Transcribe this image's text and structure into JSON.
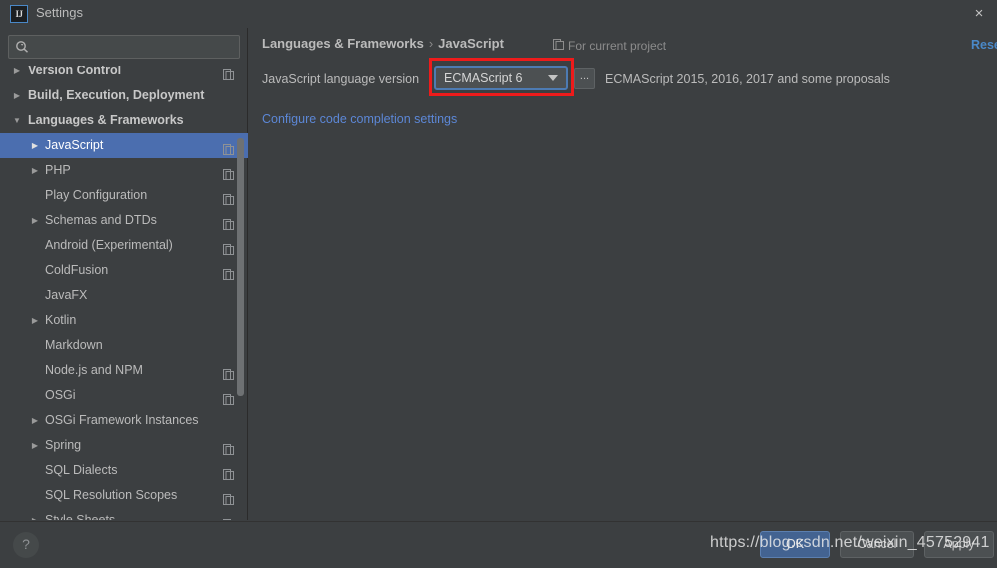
{
  "window": {
    "title": "Settings",
    "logo_text": "IJ",
    "close_icon": "×"
  },
  "search": {
    "value": "",
    "placeholder": ""
  },
  "sidebar": {
    "items": [
      {
        "label": "Version Control",
        "level": 0,
        "arrow": "▶",
        "group": true,
        "project_icon": true,
        "selected": false
      },
      {
        "label": "Build, Execution, Deployment",
        "level": 0,
        "arrow": "▶",
        "group": true,
        "project_icon": false,
        "selected": false
      },
      {
        "label": "Languages & Frameworks",
        "level": 0,
        "arrow": "▼",
        "group": true,
        "project_icon": false,
        "selected": false
      },
      {
        "label": "JavaScript",
        "level": 1,
        "arrow": "▶",
        "group": false,
        "project_icon": true,
        "selected": true
      },
      {
        "label": "PHP",
        "level": 1,
        "arrow": "▶",
        "group": false,
        "project_icon": true,
        "selected": false
      },
      {
        "label": "Play Configuration",
        "level": 1,
        "arrow": "",
        "group": false,
        "project_icon": true,
        "selected": false
      },
      {
        "label": "Schemas and DTDs",
        "level": 1,
        "arrow": "▶",
        "group": false,
        "project_icon": true,
        "selected": false
      },
      {
        "label": "Android (Experimental)",
        "level": 1,
        "arrow": "",
        "group": false,
        "project_icon": true,
        "selected": false
      },
      {
        "label": "ColdFusion",
        "level": 1,
        "arrow": "",
        "group": false,
        "project_icon": true,
        "selected": false
      },
      {
        "label": "JavaFX",
        "level": 1,
        "arrow": "",
        "group": false,
        "project_icon": false,
        "selected": false
      },
      {
        "label": "Kotlin",
        "level": 1,
        "arrow": "▶",
        "group": false,
        "project_icon": false,
        "selected": false
      },
      {
        "label": "Markdown",
        "level": 1,
        "arrow": "",
        "group": false,
        "project_icon": false,
        "selected": false
      },
      {
        "label": "Node.js and NPM",
        "level": 1,
        "arrow": "",
        "group": false,
        "project_icon": true,
        "selected": false
      },
      {
        "label": "OSGi",
        "level": 1,
        "arrow": "",
        "group": false,
        "project_icon": true,
        "selected": false
      },
      {
        "label": "OSGi Framework Instances",
        "level": 1,
        "arrow": "▶",
        "group": false,
        "project_icon": false,
        "selected": false
      },
      {
        "label": "Spring",
        "level": 1,
        "arrow": "▶",
        "group": false,
        "project_icon": true,
        "selected": false
      },
      {
        "label": "SQL Dialects",
        "level": 1,
        "arrow": "",
        "group": false,
        "project_icon": true,
        "selected": false
      },
      {
        "label": "SQL Resolution Scopes",
        "level": 1,
        "arrow": "",
        "group": false,
        "project_icon": true,
        "selected": false
      },
      {
        "label": "Style Sheets",
        "level": 1,
        "arrow": "▶",
        "group": false,
        "project_icon": true,
        "selected": false
      }
    ]
  },
  "content": {
    "breadcrumb_parent": "Languages & Frameworks",
    "breadcrumb_separator": "›",
    "breadcrumb_current": "JavaScript",
    "for_current_project": "For current project",
    "reset_label": "Reset",
    "language_version_label": "JavaScript language version",
    "combo_value": "ECMAScript 6",
    "ellipsis_label": "...",
    "version_description": "ECMAScript 2015, 2016, 2017 and some proposals",
    "completion_link": "Configure code completion settings"
  },
  "footer": {
    "help_label": "?",
    "ok_label": "OK",
    "cancel_label": "Cancel",
    "apply_label": "Apply"
  },
  "watermark": {
    "text": "https://blog.csdn.net/weixin_45752941"
  },
  "colors": {
    "background": "#3c3f41",
    "selection": "#4b6eaf",
    "link": "#5c87d6",
    "accent_blue": "#4a88c7",
    "highlight_red": "#ee1b1b",
    "default_button": "#436391"
  }
}
